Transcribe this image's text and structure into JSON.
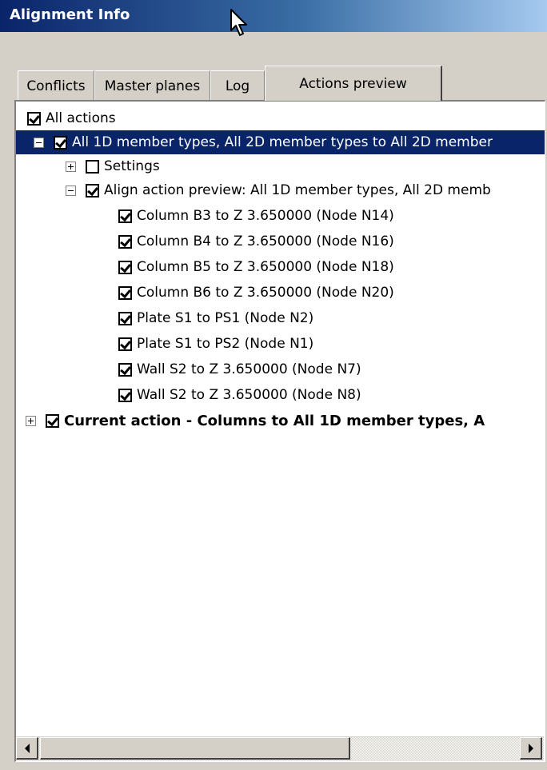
{
  "window": {
    "title": "Alignment Info"
  },
  "tabs": [
    {
      "label": "Conflicts"
    },
    {
      "label": "Master planes"
    },
    {
      "label": "Log"
    },
    {
      "label": "Actions preview",
      "active": true
    }
  ],
  "tree": {
    "root_label": "All actions",
    "group1_label": "All 1D member types, All 2D member types to All 2D member",
    "settings_label": "Settings",
    "align_preview_label": "Align action preview: All 1D member types, All 2D memb",
    "items": [
      "Column B3 to Z 3.650000 (Node N14)",
      "Column B4 to Z 3.650000 (Node N16)",
      "Column B5 to Z 3.650000 (Node N18)",
      "Column B6 to Z 3.650000 (Node N20)",
      "Plate S1 to PS1 (Node N2)",
      "Plate S1 to PS2 (Node N1)",
      "Wall S2 to Z 3.650000 (Node N7)",
      "Wall S2 to Z 3.650000 (Node N8)"
    ],
    "current_action_label": "Current action - Columns to All 1D member types, A"
  },
  "icons": {
    "cursor": "arrow-cursor-icon",
    "expand": "plus-expander-icon",
    "collapse": "minus-expander-icon",
    "checkbox": "checkbox-checked-icon"
  },
  "colors": {
    "selection": "#0a246a",
    "window_bg": "#d4d0c8"
  }
}
